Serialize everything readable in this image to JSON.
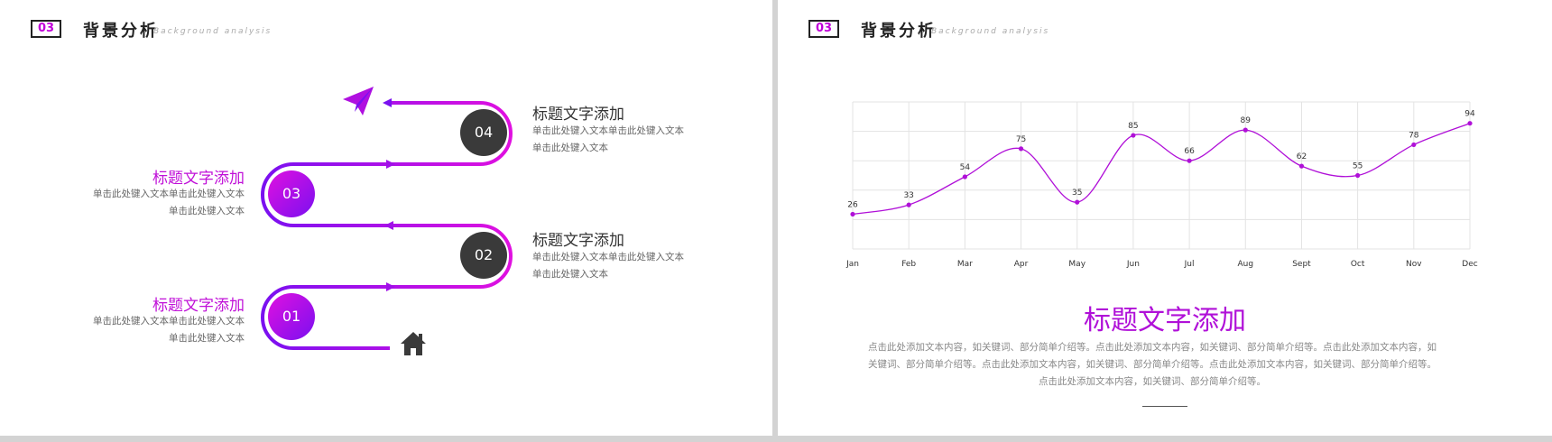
{
  "left_slide": {
    "header": {
      "number": "03",
      "title": "背景分析",
      "subtitle": "Background analysis"
    },
    "steps": [
      {
        "number": "04",
        "title": "标题文字添加",
        "desc_line1": "单击此处键入文本单击此处键入文本",
        "desc_line2": "单击此处键入文本"
      },
      {
        "number": "03",
        "title": "标题文字添加",
        "desc_line1": "单击此处键入文本单击此处键入文本",
        "desc_line2": "单击此处键入文本"
      },
      {
        "number": "02",
        "title": "标题文字添加",
        "desc_line1": "单击此处键入文本单击此处键入文本",
        "desc_line2": "单击此处键入文本"
      },
      {
        "number": "01",
        "title": "标题文字添加",
        "desc_line1": "单击此处键入文本单击此处键入文本",
        "desc_line2": "单击此处键入文本"
      }
    ],
    "icons": {
      "top": "paper-plane-icon",
      "bottom": "home-icon"
    },
    "colors": {
      "purple": "#c010d8",
      "violet": "#7a10f0",
      "dark_circle": "#3a3a3a"
    }
  },
  "right_slide": {
    "header": {
      "number": "03",
      "title": "背景分析",
      "subtitle": "Background analysis"
    },
    "main_title": "标题文字添加",
    "paragraph": "点击此处添加文本内容，如关键词、部分简单介绍等。点击此处添加文本内容，如关键词、部分简单介绍等。点击此处添加文本内容，如关键词、部分简单介绍等。点击此处添加文本内容，如关键词、部分简单介绍等。点击此处添加文本内容，如关键词、部分简单介绍等。点击此处添加文本内容，如关键词、部分简单介绍等。"
  },
  "chart_data": {
    "type": "line",
    "categories": [
      "Jan",
      "Feb",
      "Mar",
      "Apr",
      "May",
      "Jun",
      "Jul",
      "Aug",
      "Sept",
      "Oct",
      "Nov",
      "Dec"
    ],
    "series": [
      {
        "values": [
          26,
          33,
          54,
          75,
          35,
          85,
          66,
          89,
          62,
          55,
          78,
          94
        ]
      }
    ],
    "ylim": [
      0,
      110
    ],
    "grid": true,
    "line_color": "#b010d8"
  }
}
